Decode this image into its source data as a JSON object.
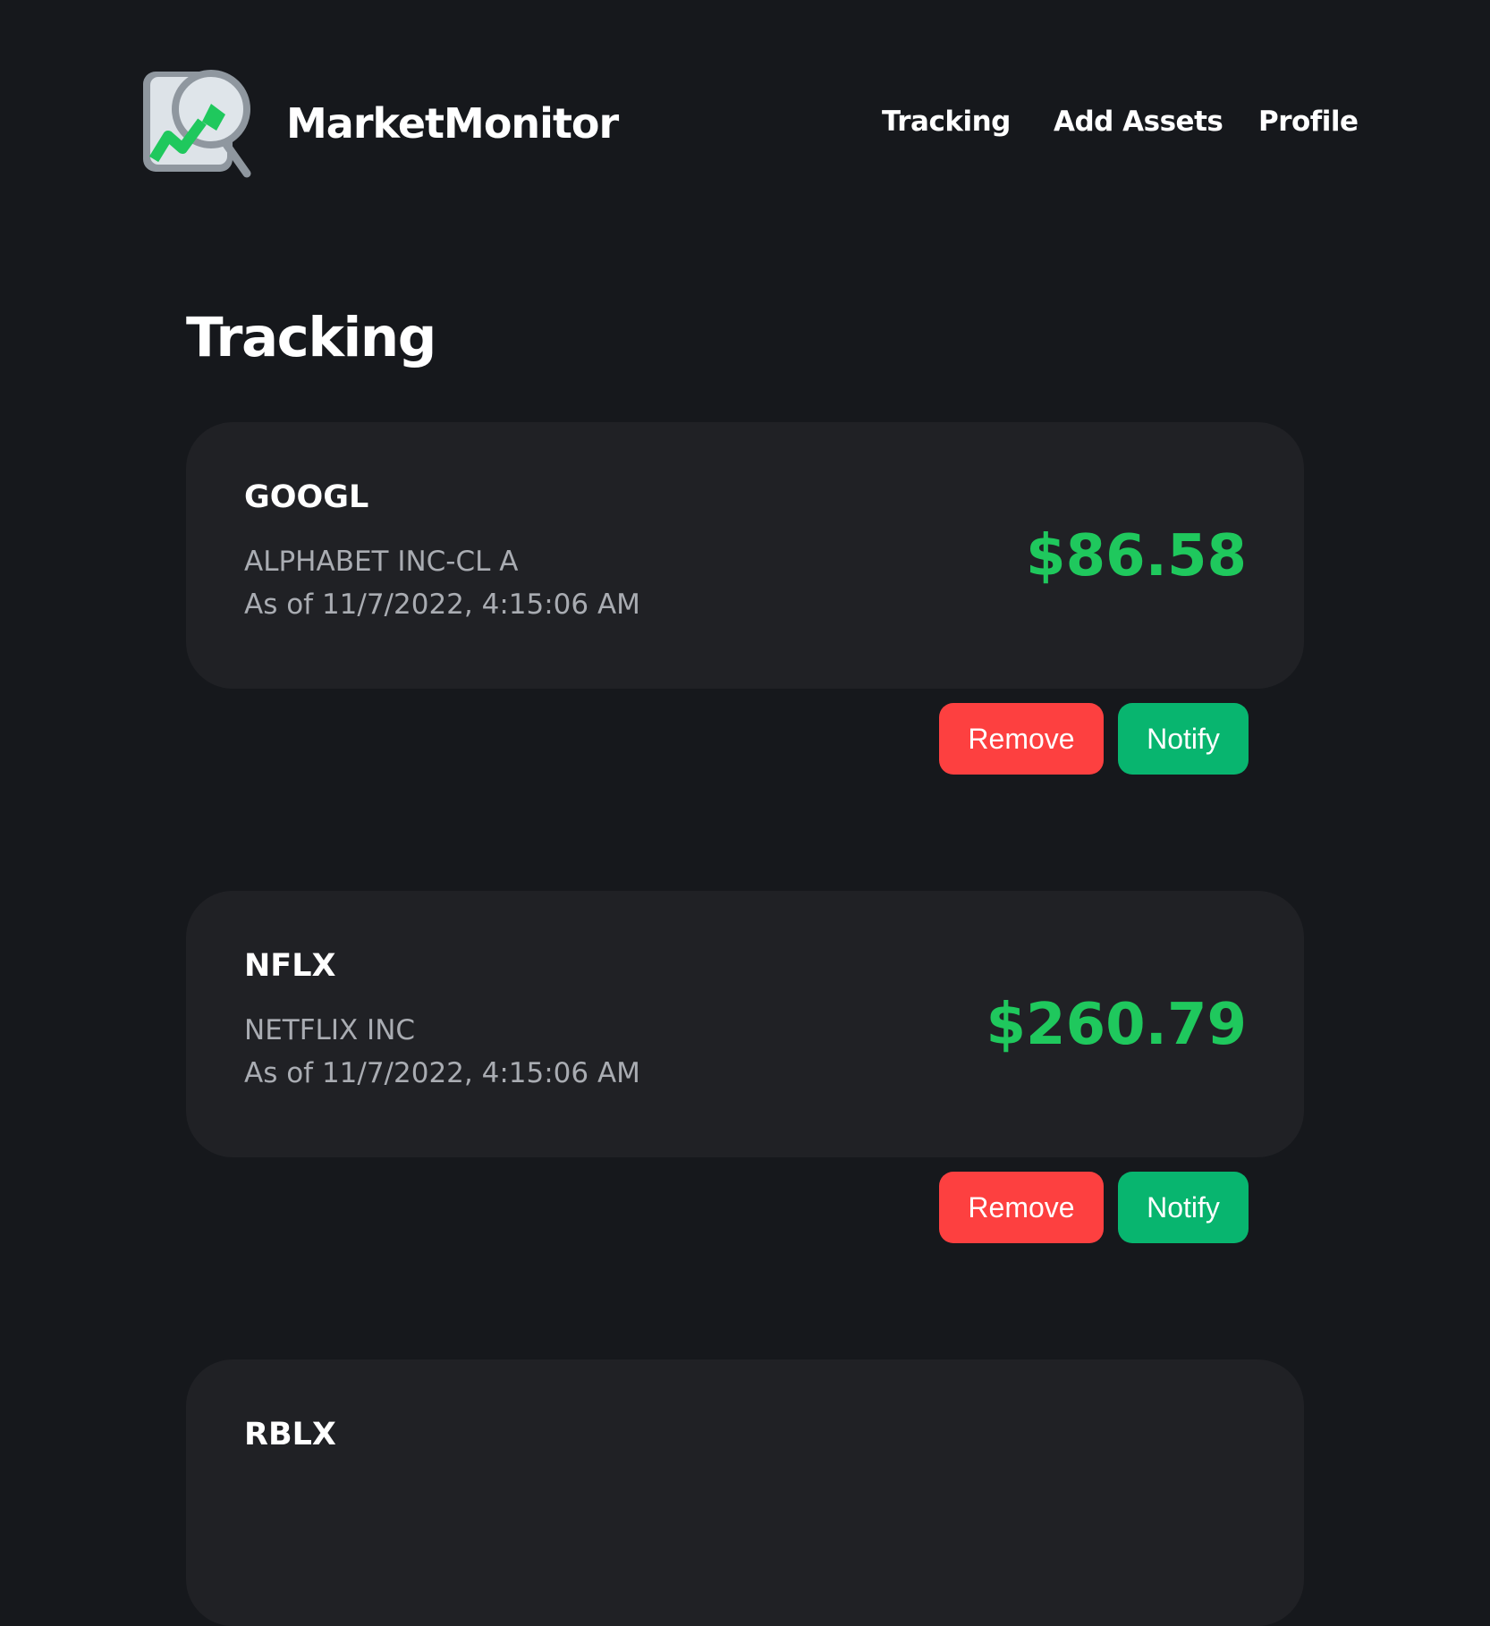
{
  "header": {
    "brand": "MarketMonitor",
    "nav": [
      {
        "label": "Tracking"
      },
      {
        "label": "Add Assets"
      },
      {
        "label": "Profile"
      }
    ]
  },
  "page": {
    "title": "Tracking"
  },
  "assets": [
    {
      "ticker": "GOOGL",
      "name": "ALPHABET INC-CL A",
      "as_of": "As of 11/7/2022, 4:15:06 AM",
      "price": "$86.58",
      "remove_label": "Remove",
      "notify_label": "Notify"
    },
    {
      "ticker": "NFLX",
      "name": "NETFLIX INC",
      "as_of": "As of 11/7/2022, 4:15:06 AM",
      "price": "$260.79",
      "remove_label": "Remove",
      "notify_label": "Notify"
    },
    {
      "ticker": "RBLX"
    }
  ],
  "colors": {
    "background": "#16181c",
    "card": "#202125",
    "price_green": "#1fc85d",
    "remove_red": "#fd4040",
    "notify_green": "#08b56f",
    "muted_text": "#a9acb2"
  },
  "icons": {
    "logo": "chart-magnifier-icon"
  }
}
